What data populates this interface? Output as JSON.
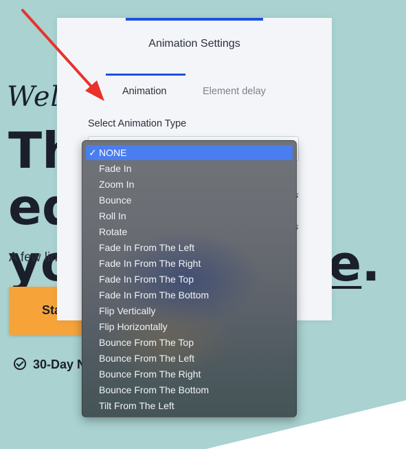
{
  "hero": {
    "script_text": "Wel",
    "headline_l1_a": "Th",
    "headline_l1_b": "eds",
    "headline_l2_a": "yo",
    "headline_l2_b": "e",
    "headline_l2_c": ".",
    "subtext": "A few lin",
    "cta_text": "Sta",
    "guarantee": "30-Day N"
  },
  "modal": {
    "title": "Animation Settings",
    "tabs": [
      {
        "label": "Animation",
        "active": true
      },
      {
        "label": "Element delay",
        "active": false
      }
    ],
    "select_label": "Select Animation Type",
    "side_links": [
      "s",
      "s"
    ]
  },
  "dropdown": {
    "selected_index": 0,
    "options": [
      "NONE",
      "Fade In",
      "Zoom In",
      "Bounce",
      "Roll In",
      "Rotate",
      "Fade In From The Left",
      "Fade In From The Right",
      "Fade In From The Top",
      "Fade In From The Bottom",
      "Flip Vertically",
      "Flip Horizontally",
      "Bounce From The Top",
      "Bounce From The Left",
      "Bounce From The Right",
      "Bounce From The Bottom",
      "Tilt From The Left"
    ],
    "check_glyph": "✓"
  },
  "colors": {
    "background": "#a9d2d1",
    "accent_blue": "#1f4fe0",
    "selected_option": "#4a7df0",
    "cta": "#f6a43a",
    "annotation_arrow": "#e8322b"
  }
}
